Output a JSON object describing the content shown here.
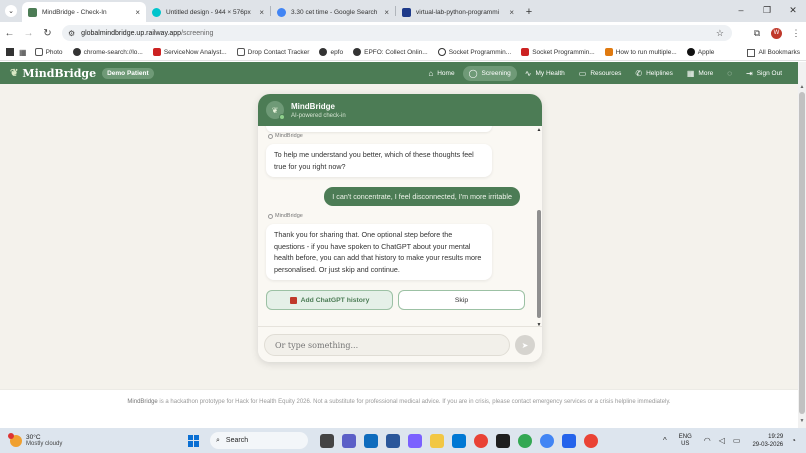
{
  "browser": {
    "tabs": [
      {
        "title": "MindBridge - Check-In",
        "active": true,
        "favicon_color": "#4c7c55"
      },
      {
        "title": "Untitled design - 944 × 576px",
        "active": false,
        "favicon_color": "#00c4cc"
      },
      {
        "title": "3.30 cet time - Google Search",
        "active": false,
        "favicon_color": "#4285f4"
      },
      {
        "title": "virtual-lab-python-programmi",
        "active": false,
        "favicon_color": "#1e3a8a"
      }
    ],
    "url_host": "globalmindbridge.up.railway.app",
    "url_path": "/screening",
    "profile_initial": "W",
    "bookmarks": [
      {
        "label": "Photo",
        "color": "#555555"
      },
      {
        "label": "chrome-search://lo...",
        "color": "#333333"
      },
      {
        "label": "ServiceNow Analyst...",
        "color": "#cc2222"
      },
      {
        "label": "Drop Contact Tracker",
        "color": "#555555"
      },
      {
        "label": "epfo",
        "color": "#333333"
      },
      {
        "label": "EPFO: Collect Onlin...",
        "color": "#333333"
      },
      {
        "label": "Socket Programmin...",
        "color": "#333333"
      },
      {
        "label": "Socket Programmin...",
        "color": "#cc2222"
      },
      {
        "label": "How to run multiple...",
        "color": "#e07a10"
      },
      {
        "label": "Apple",
        "color": "#111111"
      }
    ],
    "all_bookmarks": "All Bookmarks"
  },
  "app": {
    "brand": "MindBridge",
    "badge": "Demo Patient",
    "nav": [
      {
        "label": "Home",
        "icon": "home-icon",
        "glyph": "⌂",
        "active": false
      },
      {
        "label": "Screening",
        "icon": "chat-icon",
        "glyph": "◯",
        "active": true
      },
      {
        "label": "My Health",
        "icon": "pulse-icon",
        "glyph": "∿",
        "active": false
      },
      {
        "label": "Resources",
        "icon": "book-icon",
        "glyph": "▭",
        "active": false
      },
      {
        "label": "Helplines",
        "icon": "phone-icon",
        "glyph": "✆",
        "active": false
      },
      {
        "label": "More",
        "icon": "grid-icon",
        "glyph": "▦",
        "active": false
      },
      {
        "label": "",
        "icon": "whatsapp-icon",
        "glyph": "◌",
        "active": false
      },
      {
        "label": "Sign Out",
        "icon": "signout-icon",
        "glyph": "⇥",
        "active": false
      }
    ]
  },
  "chat": {
    "title": "MindBridge",
    "subtitle": "AI-powered check-in",
    "messages": [
      {
        "sender": "MindBridge",
        "text": "To help me understand you better, which of these thoughts feel true for you right now?"
      },
      {
        "user_text": "I can't concentrate, I feel disconnected, I'm more irritable"
      },
      {
        "sender": "MindBridge",
        "text": "Thank you for sharing that. One optional step before the questions - if you have spoken to ChatGPT about your mental health before, you can add that history to make your results more personalised. Or just skip and continue."
      }
    ],
    "btn_gpt": "Add ChatGPT history",
    "btn_skip": "Skip",
    "input_placeholder": "Or type something..."
  },
  "footer": {
    "brand": "MindBridge",
    "text": " is a hackathon prototype for Hack for Health Equity 2026. Not a substitute for professional medical advice. If you are in crisis, please contact emergency services or a crisis helpline immediately."
  },
  "taskbar": {
    "temp": "30°C",
    "weather": "Mostly cloudy",
    "search": "Search",
    "lang1": "ENG",
    "lang2": "US",
    "time": "19:29",
    "date": "29-03-2026"
  }
}
